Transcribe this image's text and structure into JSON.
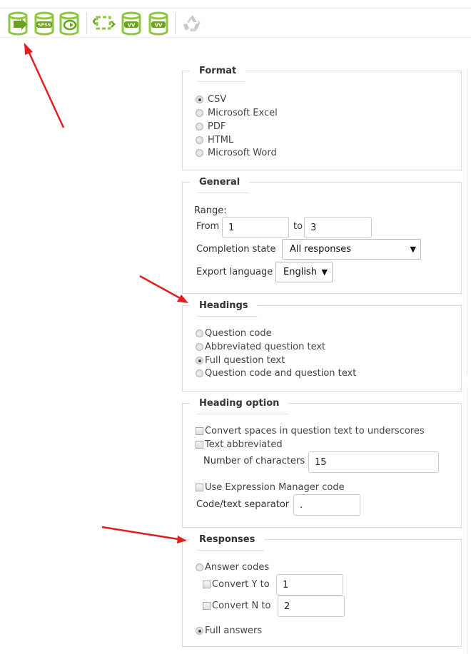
{
  "toolbar": {
    "items": [
      {
        "name": "export-results-icon"
      },
      {
        "name": "export-spss-icon",
        "text": "SPSS"
      },
      {
        "name": "export-r-icon"
      },
      {
        "name": "export-vv-survey-icon"
      },
      {
        "name": "import-vv-icon",
        "text": "VV"
      },
      {
        "name": "export-vv-icon",
        "text": "VV"
      },
      {
        "name": "recycle-icon-disabled"
      }
    ],
    "colors": {
      "icon_green": "#8dc63f",
      "icon_dark_green": "#6aa120",
      "disabled": "#c8c8c8"
    }
  },
  "format": {
    "legend": "Format",
    "options": [
      {
        "label": "CSV",
        "checked": true
      },
      {
        "label": "Microsoft Excel",
        "checked": false
      },
      {
        "label": "PDF",
        "checked": false
      },
      {
        "label": "HTML",
        "checked": false
      },
      {
        "label": "Microsoft Word",
        "checked": false
      }
    ]
  },
  "general": {
    "legend": "General",
    "range_label": "Range:",
    "from_label": "From",
    "from_value": "1",
    "to_label": "to",
    "to_value": "3",
    "completion_label": "Completion state",
    "completion_value": "All responses",
    "language_label": "Export language",
    "language_value": "English"
  },
  "headings": {
    "legend": "Headings",
    "options": [
      {
        "label": "Question code",
        "checked": false
      },
      {
        "label": "Abbreviated question text",
        "checked": false
      },
      {
        "label": "Full question text",
        "checked": true
      },
      {
        "label": "Question code and question text",
        "checked": false
      }
    ]
  },
  "heading_option": {
    "legend": "Heading option",
    "convert_spaces_label": "Convert spaces in question text to underscores",
    "text_abbreviated_label": "Text abbreviated",
    "num_chars_label": "Number of characters",
    "num_chars_value": "15",
    "em_code_label": "Use Expression Manager code",
    "separator_label": "Code/text separator",
    "separator_value": "."
  },
  "responses": {
    "legend": "Responses",
    "answer_codes_label": "Answer codes",
    "convert_y_label": "Convert Y to",
    "convert_y_value": "1",
    "convert_n_label": "Convert N to",
    "convert_n_value": "2",
    "full_answers_label": "Full answers"
  },
  "annotation_color": "#e02020"
}
